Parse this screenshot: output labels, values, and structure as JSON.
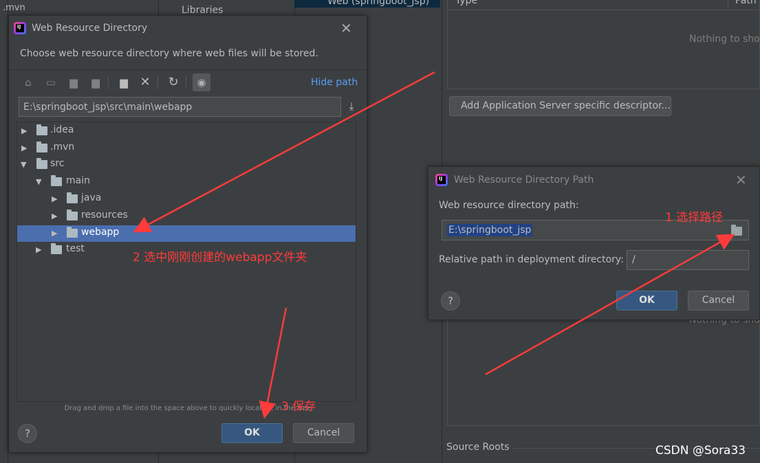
{
  "background": {
    "left_top_item": ".mvn",
    "libraries_label": "Libraries",
    "web_item_label": "Web (springboot_jsp)",
    "table_col_type": "Type",
    "table_col_path": "Path",
    "nothing_to_show": "Nothing to show",
    "add_descriptor_button": "Add Application Server specific descriptor...",
    "source_roots_label": "Source Roots"
  },
  "dialog1": {
    "title": "Web Resource Directory",
    "description": "Choose web resource directory where web files will be stored.",
    "hide_path_link": "Hide path",
    "path_value": "E:\\springboot_jsp\\src\\main\\webapp",
    "tree": [
      {
        "label": ".idea",
        "level": 0,
        "expanded": false,
        "selected": false
      },
      {
        "label": ".mvn",
        "level": 0,
        "expanded": false,
        "selected": false
      },
      {
        "label": "src",
        "level": 0,
        "expanded": true,
        "selected": false
      },
      {
        "label": "main",
        "level": 1,
        "expanded": true,
        "selected": false
      },
      {
        "label": "java",
        "level": 2,
        "expanded": false,
        "selected": false
      },
      {
        "label": "resources",
        "level": 2,
        "expanded": false,
        "selected": false
      },
      {
        "label": "webapp",
        "level": 2,
        "expanded": false,
        "selected": true
      },
      {
        "label": "test",
        "level": 1,
        "expanded": false,
        "selected": false
      }
    ],
    "drag_hint": "Drag and drop a file into the space above to quickly locate it in the tree",
    "help_label": "?",
    "ok_label": "OK",
    "cancel_label": "Cancel"
  },
  "dialog2": {
    "title": "Web Resource Directory Path",
    "path_label": "Web resource directory path:",
    "path_value": "E:\\springboot_jsp",
    "relative_label": "Relative path in deployment directory:",
    "relative_value": "/",
    "help_label": "?",
    "ok_label": "OK",
    "cancel_label": "Cancel"
  },
  "annotations": {
    "step1": "1 选择路径",
    "step2": "2 选中刚刚创建的webapp文件夹",
    "step3": "3 保存",
    "color": "#ff3b3b"
  },
  "watermark": "CSDN @Sora33",
  "colors": {
    "selection": "#4b6eaf",
    "link": "#589df6",
    "ok_button": "#365880",
    "dialog_bg": "#3c3f41"
  },
  "icons": [
    "home-icon",
    "desktop-icon",
    "project-icon",
    "module-icon",
    "new-folder-icon",
    "delete-icon",
    "refresh-icon",
    "show-hidden-icon",
    "download-icon",
    "folder-icon",
    "close-icon",
    "help-icon",
    "app-icon"
  ]
}
